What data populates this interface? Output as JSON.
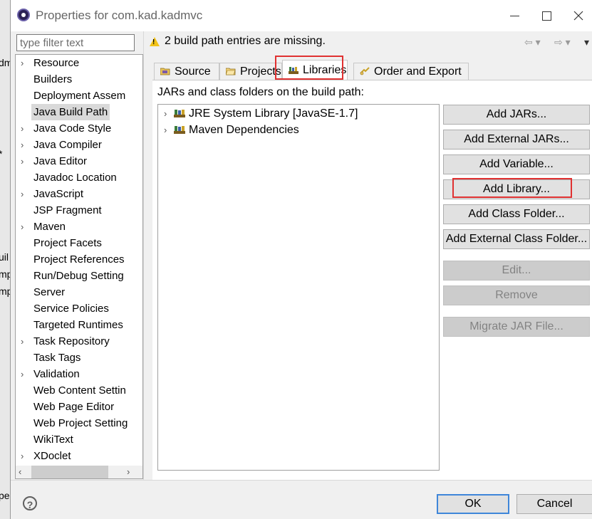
{
  "background_window": {
    "fragments": [
      "dm",
      "*",
      "uil",
      "mp",
      "mp",
      "pe"
    ]
  },
  "window": {
    "title": "Properties for com.kad.kadmvc"
  },
  "filter": {
    "placeholder": "type filter text"
  },
  "tree": {
    "items": [
      {
        "label": "Resource",
        "expandable": true
      },
      {
        "label": "Builders",
        "expandable": false
      },
      {
        "label": "Deployment Assem",
        "expandable": false
      },
      {
        "label": "Java Build Path",
        "expandable": false,
        "selected": true
      },
      {
        "label": "Java Code Style",
        "expandable": true
      },
      {
        "label": "Java Compiler",
        "expandable": true
      },
      {
        "label": "Java Editor",
        "expandable": true
      },
      {
        "label": "Javadoc Location",
        "expandable": false
      },
      {
        "label": "JavaScript",
        "expandable": true
      },
      {
        "label": "JSP Fragment",
        "expandable": false
      },
      {
        "label": "Maven",
        "expandable": true
      },
      {
        "label": "Project Facets",
        "expandable": false
      },
      {
        "label": "Project References",
        "expandable": false
      },
      {
        "label": "Run/Debug Setting",
        "expandable": false
      },
      {
        "label": "Server",
        "expandable": false
      },
      {
        "label": "Service Policies",
        "expandable": false
      },
      {
        "label": "Targeted Runtimes",
        "expandable": false
      },
      {
        "label": "Task Repository",
        "expandable": true
      },
      {
        "label": "Task Tags",
        "expandable": false
      },
      {
        "label": "Validation",
        "expandable": true
      },
      {
        "label": "Web Content Settin",
        "expandable": false
      },
      {
        "label": "Web Page Editor",
        "expandable": false
      },
      {
        "label": "Web Project Setting",
        "expandable": false
      },
      {
        "label": "WikiText",
        "expandable": false
      },
      {
        "label": "XDoclet",
        "expandable": true
      }
    ]
  },
  "header": {
    "message": "2 build path entries are missing.",
    "nav_back": "⇦ ▾",
    "nav_forward": "⇨ ▾",
    "menu": "▾"
  },
  "tabs": [
    {
      "label": "Source",
      "icon": "source-folder-icon"
    },
    {
      "label": "Projects",
      "icon": "projects-folder-icon"
    },
    {
      "label": "Libraries",
      "icon": "library-icon",
      "active": true
    },
    {
      "label": "Order and Export",
      "icon": "order-export-icon"
    }
  ],
  "libraries": {
    "label": "JARs and class folders on the build path:",
    "entries": [
      {
        "label": "JRE System Library [JavaSE-1.7]"
      },
      {
        "label": "Maven Dependencies"
      }
    ],
    "buttons": {
      "add_jars": "Add JARs...",
      "add_external_jars": "Add External JARs...",
      "add_variable": "Add Variable...",
      "add_library": "Add Library...",
      "add_class_folder": "Add Class Folder...",
      "add_external_class_folder": "Add External Class Folder...",
      "edit": "Edit...",
      "remove": "Remove",
      "migrate_jar": "Migrate JAR File..."
    }
  },
  "footer": {
    "help": "?",
    "ok": "OK",
    "cancel": "Cancel"
  },
  "colors": {
    "highlight_box": "#e03131",
    "warning": "#f2c318",
    "ok_border": "#3f86d9"
  }
}
